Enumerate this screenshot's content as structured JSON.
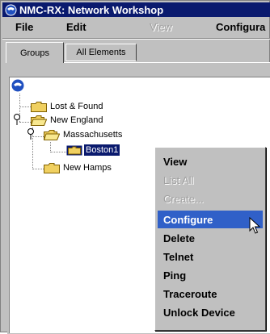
{
  "window": {
    "title": "NMC-RX: Network Workshop",
    "title_color": "#0a1a6e"
  },
  "menubar": {
    "file": "File",
    "edit": "Edit",
    "view": "View",
    "configure": "Configura"
  },
  "tabs": [
    {
      "label": "Groups",
      "active": true
    },
    {
      "label": "All Elements",
      "active": false
    }
  ],
  "tree": {
    "nodes": [
      {
        "label": "Lost & Found"
      },
      {
        "label": "New England"
      },
      {
        "label": "Massachusetts"
      },
      {
        "label": "Boston1",
        "selected": true
      },
      {
        "label": "New Hamps"
      }
    ]
  },
  "context_menu": {
    "items": [
      {
        "label": "View",
        "enabled": true
      },
      {
        "label": "List All",
        "enabled": false
      },
      {
        "label": "Create...",
        "enabled": false
      },
      {
        "label": "Configure",
        "enabled": true,
        "highlighted": true
      },
      {
        "label": "Delete",
        "enabled": true
      },
      {
        "label": "Telnet",
        "enabled": true
      },
      {
        "label": "Ping",
        "enabled": true
      },
      {
        "label": "Traceroute",
        "enabled": true
      },
      {
        "label": "Unlock Device",
        "enabled": true
      }
    ],
    "highlight_color": "#3060c8"
  },
  "colors": {
    "face": "#c0c0c0",
    "folder": "#f0d060",
    "selection": "#0a1a6e"
  }
}
